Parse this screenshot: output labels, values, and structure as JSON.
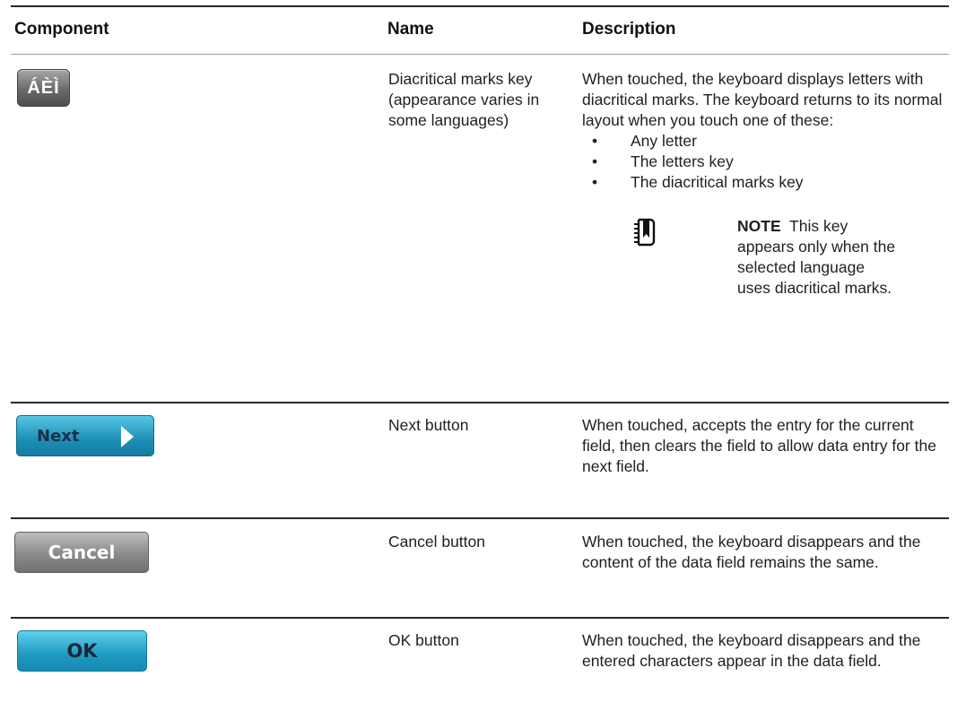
{
  "headers": {
    "component": "Component",
    "name": "Name",
    "description": "Description"
  },
  "rows": [
    {
      "key_label": "ÁÈÌ",
      "name": "Diacritical marks key (appearance varies in some languages)",
      "desc": "When touched, the keyboard displays letters with diacritical marks. The keyboard returns to its normal layout when you touch one of these:",
      "bullets": [
        "Any letter",
        "The letters key",
        "The diacritical marks key"
      ],
      "note_label": "NOTE",
      "note_text": "This key appears only when the selected language uses diacritical marks."
    },
    {
      "button_label": "Next",
      "name": "Next button",
      "desc": "When touched, accepts the entry for the current field, then clears the field to allow data entry for the next field."
    },
    {
      "button_label": "Cancel",
      "name": "Cancel button",
      "desc": "When touched, the keyboard disappears and the content of the data field remains the same."
    },
    {
      "button_label": "OK",
      "name": "OK button",
      "desc": "When touched, the keyboard disappears and the entered characters appear in the data field."
    }
  ],
  "bullet_glyph": "•",
  "colors": {
    "next_button": "#1d8fb5",
    "ok_button": "#1f9ac0",
    "cancel_button": "#8a8a8a",
    "diacritical_key": "#6a6a6a"
  }
}
